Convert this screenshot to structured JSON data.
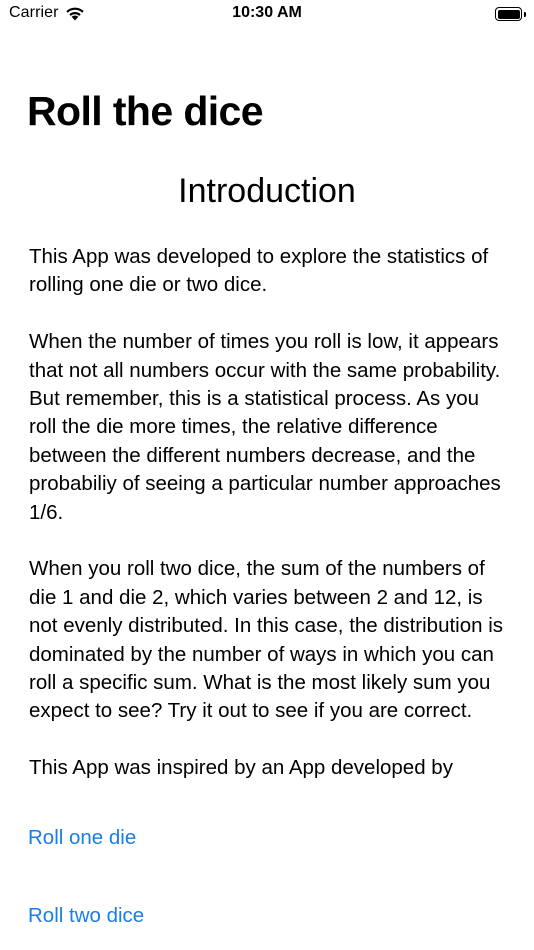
{
  "status_bar": {
    "carrier": "Carrier",
    "time": "10:30 AM",
    "wifi_icon": "wifi-icon",
    "battery_icon": "battery-full-icon"
  },
  "nav": {
    "title": "Roll the dice"
  },
  "intro": {
    "heading": "Introduction",
    "paragraphs": [
      "This App was developed to explore the statistics of rolling one die or two dice.",
      "When the number of times you roll is low, it appears that not all numbers occur with the same probability.  But remember, this is a statistical process.  As you roll the die more times, the relative difference between the different numbers decrease, and the probabiliy of seeing a particular number approaches 1/6.",
      "When you roll two dice, the sum of the numbers of die 1 and die 2, which varies between 2 and 12, is not evenly distributed.  In this case, the distribution is dominated by the number of ways in which you can roll a specific sum.  What is the most likely sum you expect to see?  Try it out to see if you are correct.",
      "This App was inspired by an App developed by"
    ]
  },
  "actions": {
    "roll_one_label": "Roll one die",
    "roll_two_label": "Roll two dice"
  },
  "colors": {
    "link": "#1a7ee6",
    "background": "#ffffff",
    "text": "#000000"
  }
}
